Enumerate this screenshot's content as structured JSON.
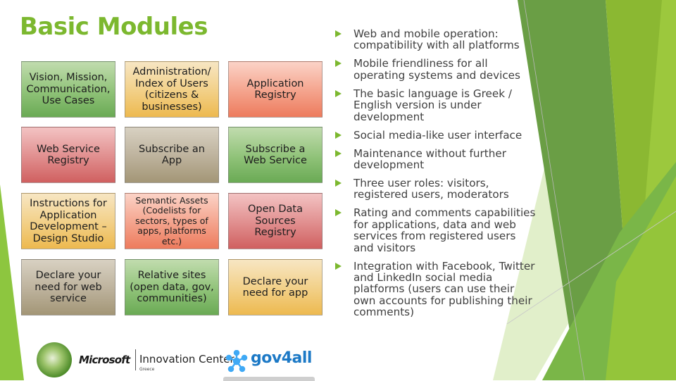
{
  "slide": {
    "title": "Basic Modules",
    "accent_color": "#7cb82f"
  },
  "modules": [
    {
      "label": "Vision, Mission, Communication, Use Cases",
      "color": "green"
    },
    {
      "label": "Administration/ Index of Users (citizens & businesses)",
      "color": "tan"
    },
    {
      "label": "Application Registry",
      "color": "coral"
    },
    {
      "label": "Web Service Registry",
      "color": "red"
    },
    {
      "label": "Subscribe an App",
      "color": "taupe"
    },
    {
      "label": "Subscribe a Web Service",
      "color": "green"
    },
    {
      "label": "Instructions for Application Development – Design Studio",
      "color": "tan"
    },
    {
      "label": "Semantic Assets (Codelists for sectors, types of apps, platforms etc.)",
      "color": "coral"
    },
    {
      "label": "Open Data Sources Registry",
      "color": "red"
    },
    {
      "label": "Declare your need for  web service",
      "color": "taupe"
    },
    {
      "label": "Relative sites (open data, gov, communities)",
      "color": "green"
    },
    {
      "label": "Declare your need for app",
      "color": "tan"
    }
  ],
  "features": [
    "Web and mobile operation: compatibility with all platforms",
    "Mobile friendliness for all operating systems and devices",
    "The basic language is Greek / English version is under development",
    "Social media-like user interface",
    "Maintenance without further development",
    "Three user roles: visitors, registered users, moderators",
    "Rating and comments capabilities for applications, data and web services from registered users and visitors",
    "Integration with Facebook, Twitter and LinkedIn social media platforms (users can use their own accounts for publishing their comments)"
  ],
  "logos": {
    "microsoft": "Microsoft",
    "innovation_center": "Innovation Center",
    "innovation_center_sub": "Greece",
    "gov4all": "gov4all"
  }
}
